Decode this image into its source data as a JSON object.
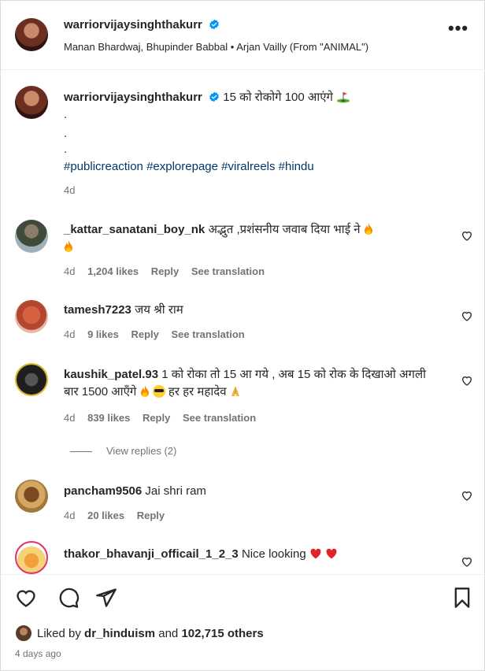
{
  "header": {
    "username": "warriorvijaysinghthakurr",
    "audio": "Manan Bhardwaj, Bhupinder Babbal • Arjan Vailly (From \"ANIMAL\")",
    "more_label": "•••"
  },
  "caption": {
    "username": "warriorvijaysinghthakurr",
    "text": "15 को रोकोगे 100 आएंगे",
    "dots": [
      ".",
      ".",
      "."
    ],
    "hashtags": "#publicreaction #explorepage #viralreels #hindu",
    "time": "4d"
  },
  "comments": [
    {
      "username": "_kattar_sanatani_boy_nk",
      "text": "अद्भुत ,प्रशंसनीय जवाब दिया भाई ने",
      "time": "4d",
      "likes": "1,204 likes",
      "reply": "Reply",
      "translation": "See translation"
    },
    {
      "username": "tamesh7223",
      "text": "जय श्री राम",
      "time": "4d",
      "likes": "9 likes",
      "reply": "Reply",
      "translation": "See translation"
    },
    {
      "username": "kaushik_patel.93",
      "text": "1 को रोका तो 15 आ गये , अब 15 को रोक के दिखाओ अगली बार 1500 आएँगे",
      "text_tail": "हर हर महादेव",
      "time": "4d",
      "likes": "839 likes",
      "reply": "Reply",
      "translation": "See translation",
      "view_replies": "View replies (2)"
    },
    {
      "username": "pancham9506",
      "text": "Jai shri ram",
      "time": "4d",
      "likes": "20 likes",
      "reply": "Reply"
    },
    {
      "username": "thakor_bhavanji_officail_1_2_3",
      "text": "Nice looking"
    }
  ],
  "footer": {
    "liked_prefix": "Liked by",
    "liked_user": "dr_hinduism",
    "liked_mid": "and",
    "liked_count": "102,715 others",
    "post_time": "4 days ago"
  },
  "colors": {
    "text": "#262626",
    "muted": "#737373",
    "hashtag": "#00376b",
    "verified": "#0095f6",
    "heart_red": "#ed4956"
  }
}
